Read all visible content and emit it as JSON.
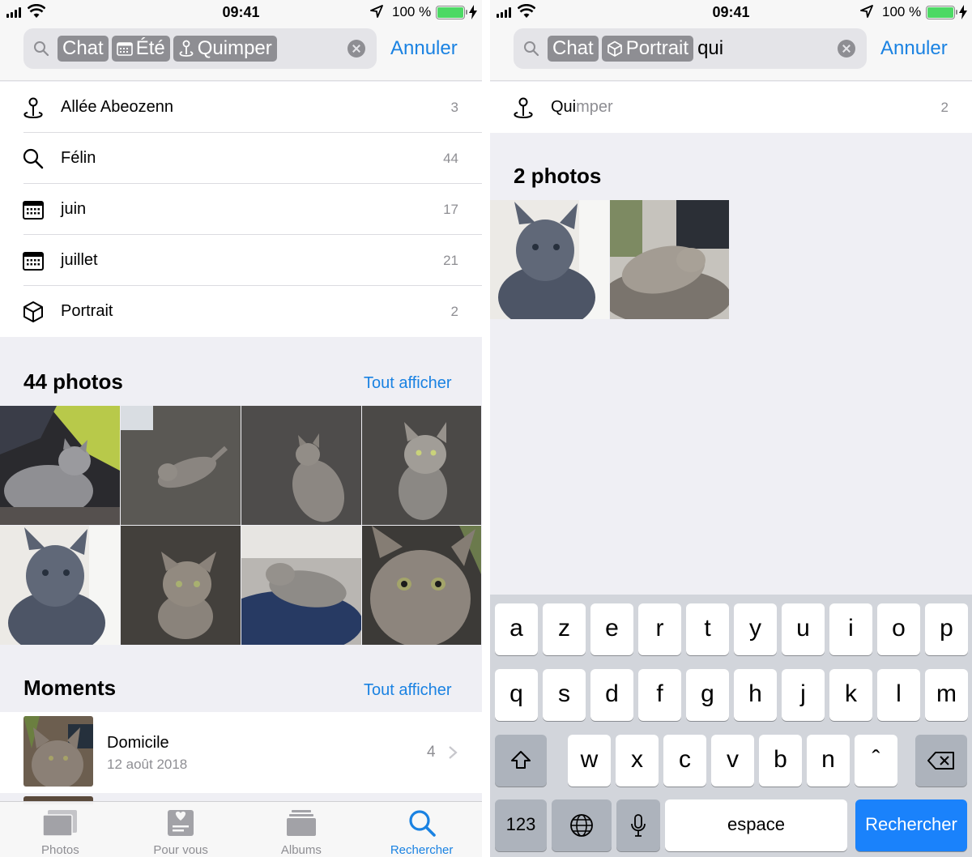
{
  "status_bar": {
    "time": "09:41",
    "battery_text": "100 %",
    "battery_level": 1.0
  },
  "left": {
    "search": {
      "tokens": [
        {
          "label": "Chat",
          "icon": "none"
        },
        {
          "label": "Été",
          "icon": "calendar-icon"
        },
        {
          "label": "Quimper",
          "icon": "location-pin-icon"
        }
      ],
      "typed_text": "",
      "cancel_label": "Annuler"
    },
    "suggestions": [
      {
        "label": "Allée Abeozenn",
        "count": "3",
        "icon": "location-pin-icon"
      },
      {
        "label": "Félin",
        "count": "44",
        "icon": "search-icon"
      },
      {
        "label": "juin",
        "count": "17",
        "icon": "calendar-icon"
      },
      {
        "label": "juillet",
        "count": "21",
        "icon": "calendar-icon"
      },
      {
        "label": "Portrait",
        "count": "2",
        "icon": "cube-icon"
      }
    ],
    "photos_section": {
      "title": "44 photos",
      "see_all": "Tout afficher"
    },
    "moments_section": {
      "title": "Moments",
      "see_all": "Tout afficher"
    },
    "moment": {
      "title": "Domicile",
      "date": "12 août 2018",
      "count": "4"
    },
    "tabbar": [
      {
        "label": "Photos",
        "icon": "photos-stack-icon",
        "active": false
      },
      {
        "label": "Pour vous",
        "icon": "for-you-icon",
        "active": false
      },
      {
        "label": "Albums",
        "icon": "albums-icon",
        "active": false
      },
      {
        "label": "Rechercher",
        "icon": "search-icon",
        "active": true
      }
    ]
  },
  "right": {
    "search": {
      "tokens": [
        {
          "label": "Chat",
          "icon": "none"
        },
        {
          "label": "Portrait",
          "icon": "cube-icon"
        }
      ],
      "typed_text": "qui",
      "cancel_label": "Annuler"
    },
    "suggestion": {
      "label_match": "Qui",
      "label_rest": "mper",
      "count": "2",
      "icon": "location-pin-icon"
    },
    "photos_section": {
      "title": "2 photos"
    },
    "keyboard": {
      "row1": [
        "a",
        "z",
        "e",
        "r",
        "t",
        "y",
        "u",
        "i",
        "o",
        "p"
      ],
      "row2": [
        "q",
        "s",
        "d",
        "f",
        "g",
        "h",
        "j",
        "k",
        "l",
        "m"
      ],
      "row3": [
        "w",
        "x",
        "c",
        "v",
        "b",
        "n",
        "ˆ"
      ],
      "numbers_key": "123",
      "space_key": "espace",
      "return_key": "Rechercher"
    }
  }
}
